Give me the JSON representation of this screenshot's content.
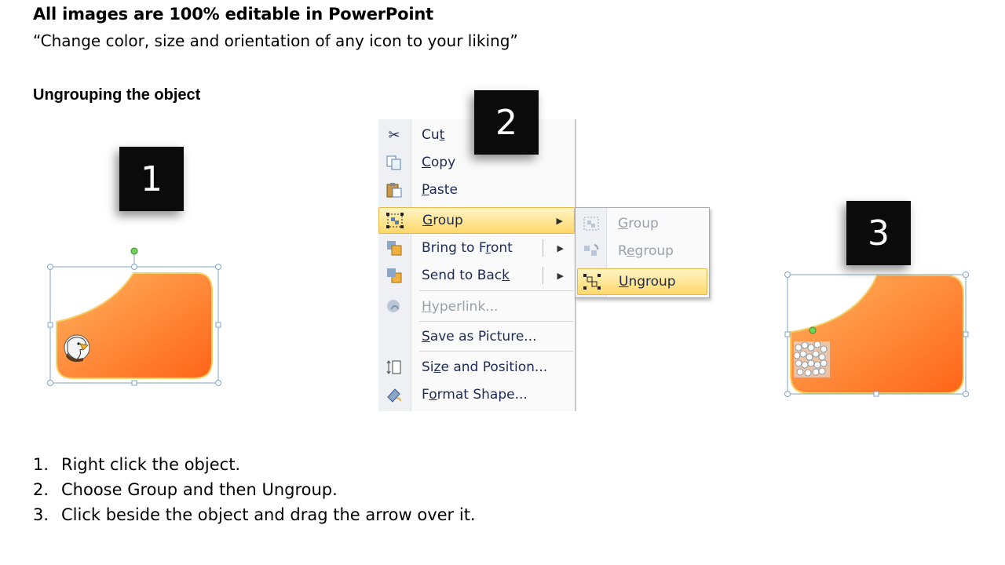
{
  "header": {
    "title": "All images are 100% editable in PowerPoint",
    "subtitle": "“Change color, size and orientation of any icon to your liking”",
    "section": "Ungrouping the object"
  },
  "steps_boxes": [
    "1",
    "2",
    "3"
  ],
  "context_menu": {
    "items": [
      {
        "pre": "Cu",
        "ul": "t",
        "post": "",
        "icon": "scissors-icon"
      },
      {
        "pre": "",
        "ul": "C",
        "post": "opy",
        "icon": "copy-icon"
      },
      {
        "pre": "",
        "ul": "P",
        "post": "aste",
        "icon": "paste-icon"
      },
      {
        "pre": "",
        "ul": "G",
        "post": "roup",
        "icon": "group-icon"
      },
      {
        "pre": "Bring to F",
        "ul": "r",
        "post": "ont",
        "icon": "bring-to-front-icon"
      },
      {
        "pre": "Send to Bac",
        "ul": "k",
        "post": "",
        "icon": "send-to-back-icon"
      },
      {
        "pre": "",
        "ul": "H",
        "post": "yperlink...",
        "icon": "hyperlink-icon"
      },
      {
        "pre": "",
        "ul": "S",
        "post": "ave as Picture...",
        "icon": ""
      },
      {
        "pre": "Si",
        "ul": "z",
        "post": "e and Position...",
        "icon": "size-position-icon"
      },
      {
        "pre": "F",
        "ul": "o",
        "post": "rmat Shape...",
        "icon": "format-shape-icon"
      }
    ]
  },
  "submenu": {
    "items": [
      {
        "pre": "",
        "ul": "G",
        "post": "roup",
        "icon": "group-icon"
      },
      {
        "pre": "R",
        "ul": "e",
        "post": "group",
        "icon": "regroup-icon"
      },
      {
        "pre": "",
        "ul": "U",
        "post": "ngroup",
        "icon": "ungroup-icon"
      }
    ]
  },
  "instructions": [
    {
      "num": "1.",
      "text": "Right click the object."
    },
    {
      "num": "2.",
      "text": "Choose Group and then Ungroup."
    },
    {
      "num": "3.",
      "text": "Click beside the object and drag the arrow over it."
    }
  ],
  "colors": {
    "shape_light": "#ffa64d",
    "shape_dark": "#ff6a1a",
    "menu_highlight": "#ffd86b",
    "menu_text": "#1c2a55",
    "selection_handle": "#7da6c9"
  }
}
